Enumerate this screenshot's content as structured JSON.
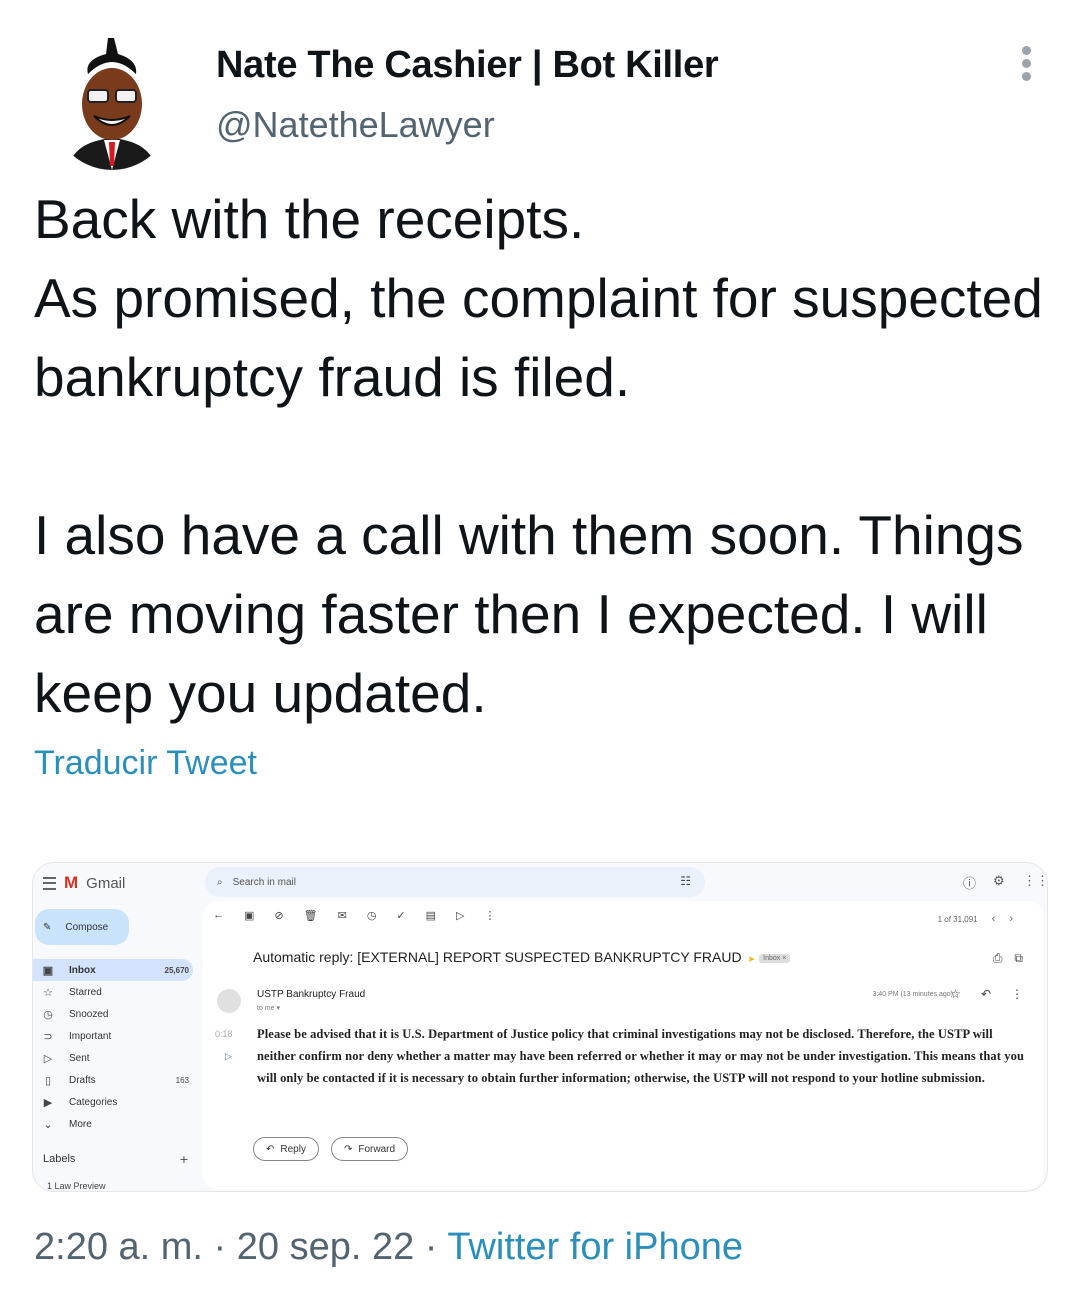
{
  "tweet": {
    "author_name": "Nate The Cashier | Bot Killer",
    "handle": "@NatetheLawyer",
    "text": "Back with the receipts.\nAs promised, the complaint for suspected bankruptcy fraud is filed.\n\nI also have a call with them soon. Things are moving faster then I expected. I will keep you updated.",
    "translate_label": "Traducir Tweet",
    "timestamp": "2:20 a. m. · 20 sep. 22 · ",
    "source": "Twitter for iPhone",
    "avatar_icon": "cartoon-avatar-icon"
  },
  "gmail": {
    "app_name": "Gmail",
    "compose_label": "Compose",
    "search_placeholder": "Search in mail",
    "nav": [
      {
        "label": "Inbox",
        "count": "25,670",
        "icon": "inbox-icon"
      },
      {
        "label": "Starred",
        "count": "",
        "icon": "star-icon"
      },
      {
        "label": "Snoozed",
        "count": "",
        "icon": "clock-icon"
      },
      {
        "label": "Important",
        "count": "",
        "icon": "important-icon"
      },
      {
        "label": "Sent",
        "count": "",
        "icon": "send-icon"
      },
      {
        "label": "Drafts",
        "count": "163",
        "icon": "draft-icon"
      },
      {
        "label": "Categories",
        "count": "",
        "icon": "label-icon"
      },
      {
        "label": "More",
        "count": "",
        "icon": "chevron-down-icon"
      }
    ],
    "labels_heading": "Labels",
    "label_item": "1 Law Preview",
    "pager": "1 of 31,091",
    "subject": "Automatic reply: [EXTERNAL] REPORT SUSPECTED BANKRUPTCY FRAUD",
    "subject_tag": "Inbox ×",
    "sender": "USTP Bankruptcy Fraud",
    "to_me": "to me ▾",
    "time": "3:40 PM (13 minutes ago)",
    "audio_time": "0:18",
    "body": "Please be advised that it is U.S. Department of Justice policy that criminal investigations may not be disclosed. Therefore, the USTP will neither confirm nor deny whether a matter may have been referred or whether it may or may not be under investigation. This means that you will only be contacted if it is necessary to obtain further information; otherwise, the USTP will not respond to your hotline submission.",
    "reply_label": "Reply",
    "forward_label": "Forward"
  }
}
